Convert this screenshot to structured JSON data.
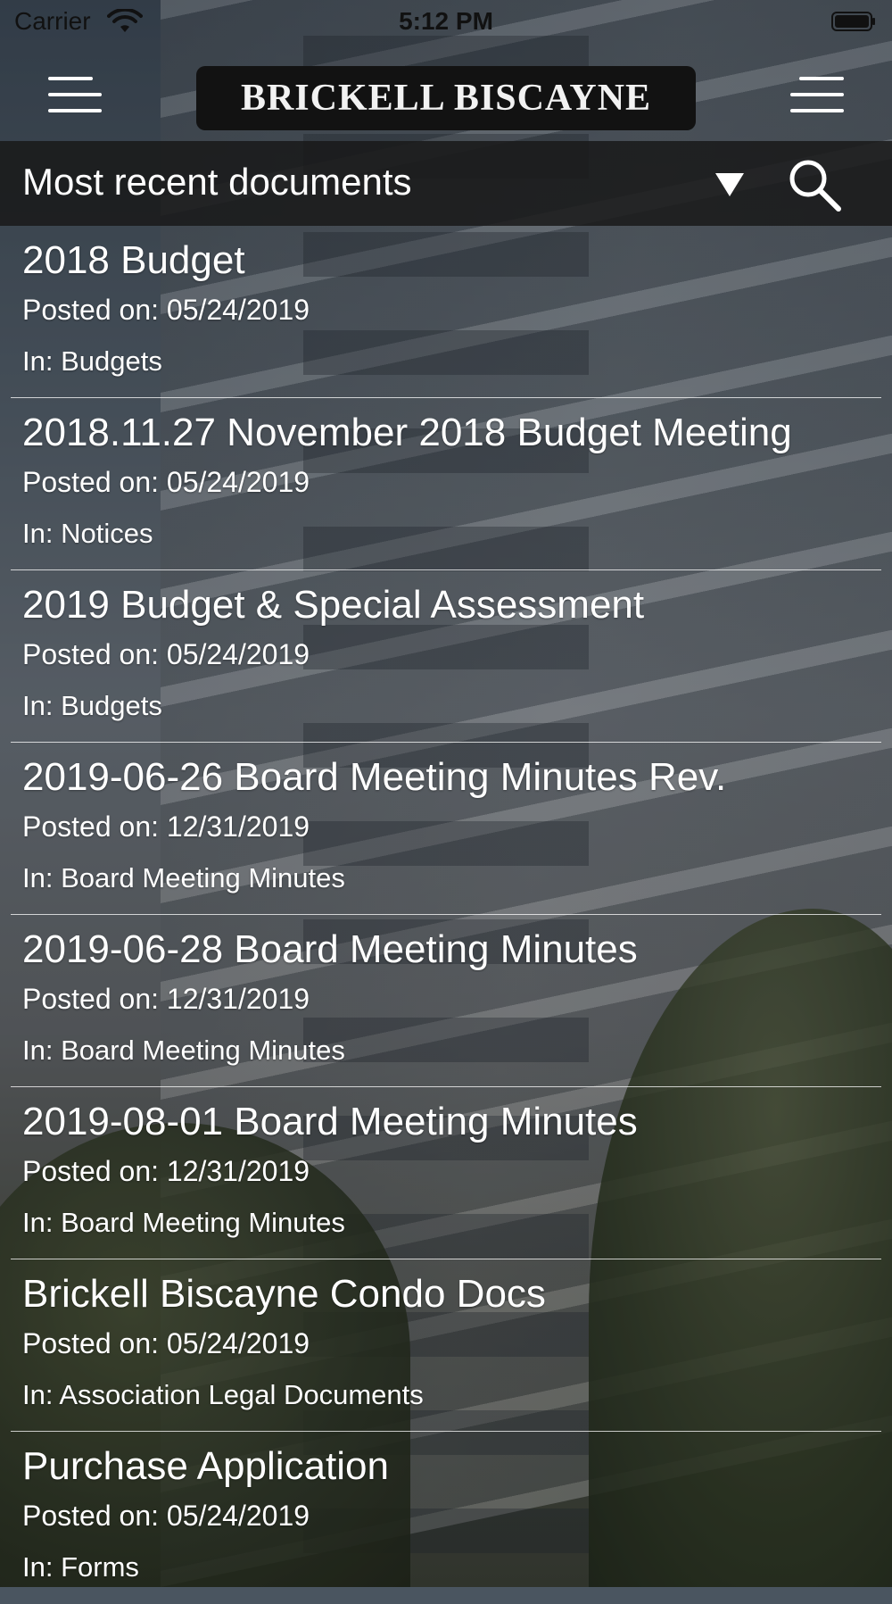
{
  "status_bar": {
    "carrier": "Carrier",
    "time": "5:12 PM"
  },
  "header": {
    "logo_text": "BRICKELL BISCAYNE",
    "left_icon": "hamburger-menu-icon",
    "right_icon": "hamburger-menu-icon"
  },
  "filter": {
    "label": "Most recent documents",
    "dropdown_icon": "triangle-down-icon",
    "search_icon": "search-icon"
  },
  "documents": [
    {
      "title": "2018 Budget",
      "posted": "Posted on: 05/24/2019",
      "category": "In: Budgets"
    },
    {
      "title": "2018.11.27 November 2018 Budget Meeting",
      "posted": "Posted on: 05/24/2019",
      "category": "In: Notices"
    },
    {
      "title": "2019 Budget & Special Assessment",
      "posted": "Posted on: 05/24/2019",
      "category": "In: Budgets"
    },
    {
      "title": "2019-06-26 Board Meeting Minutes Rev.",
      "posted": "Posted on: 12/31/2019",
      "category": "In: Board Meeting Minutes"
    },
    {
      "title": "2019-06-28 Board Meeting Minutes",
      "posted": "Posted on: 12/31/2019",
      "category": "In: Board Meeting Minutes"
    },
    {
      "title": "2019-08-01 Board Meeting Minutes",
      "posted": "Posted on: 12/31/2019",
      "category": "In: Board Meeting Minutes"
    },
    {
      "title": "Brickell Biscayne Condo Docs",
      "posted": "Posted on: 05/24/2019",
      "category": "In: Association Legal Documents"
    },
    {
      "title": "Purchase Application",
      "posted": "Posted on: 05/24/2019",
      "category": "In: Forms"
    }
  ],
  "colors": {
    "filter_bar_bg": "#191919",
    "logo_bg": "#121212",
    "text": "#ffffff"
  }
}
